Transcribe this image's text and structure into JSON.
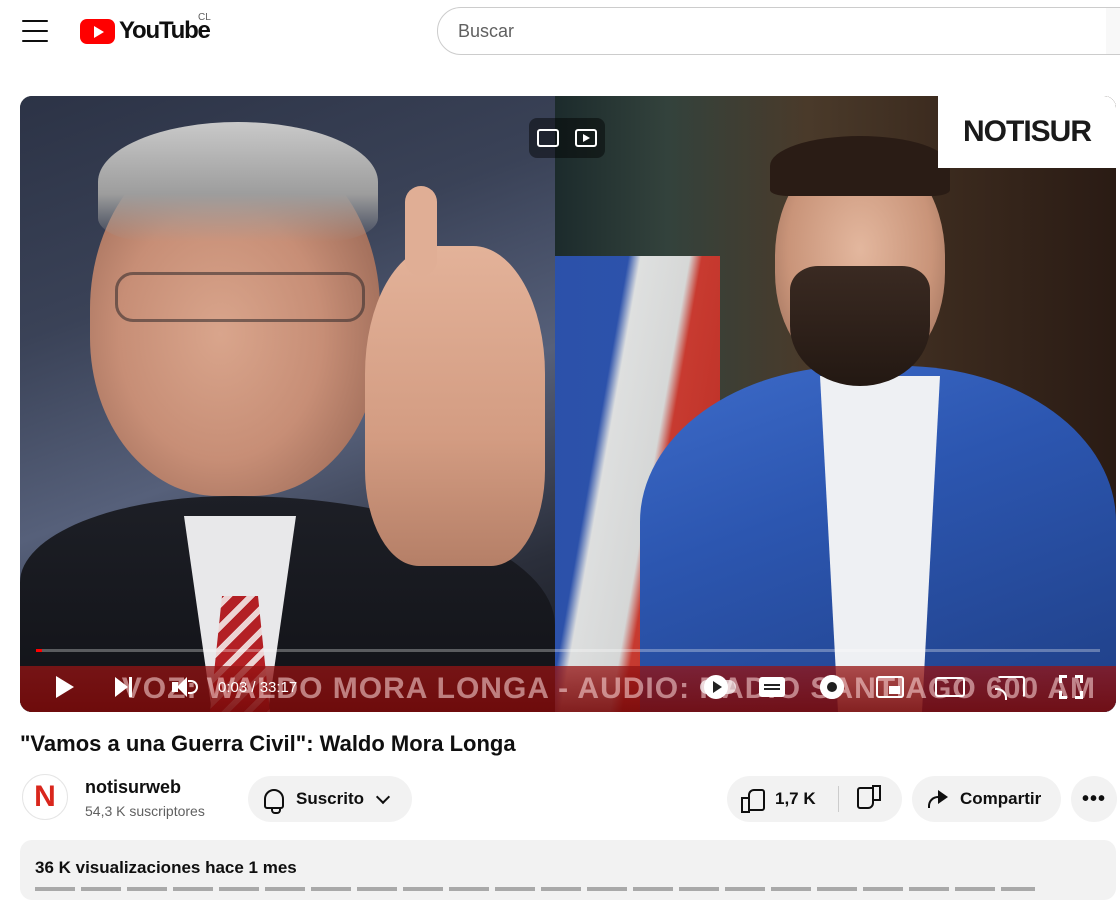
{
  "header": {
    "logo_text": "YouTube",
    "country_code": "CL",
    "search_placeholder": "Buscar"
  },
  "player": {
    "overlay_brand": "NOTISUR",
    "caption_text": "VOZ: WALDO MORA LONGA - AUDIO: RADIO SANTIAGO 600 AM",
    "time_current": "0:03",
    "time_total": "33:17",
    "time_display": "0:03 / 33:17",
    "progress_fraction": 0.0015
  },
  "video": {
    "title": "\"Vamos a una Guerra Civil\": Waldo Mora Longa",
    "channel_name": "notisurweb",
    "channel_avatar_letter": "N",
    "subscribers": "54,3 K suscriptores",
    "subscribe_label": "Suscrito",
    "likes": "1,7 K",
    "share_label": "Compartir",
    "more_label": "•••"
  },
  "description": {
    "stats": "36 K visualizaciones  hace 1 mes"
  },
  "colors": {
    "brand_red": "#ff0000",
    "notisur_red": "#d9261c"
  }
}
